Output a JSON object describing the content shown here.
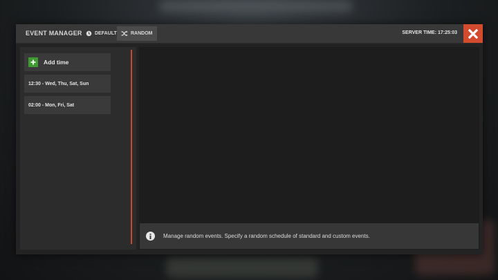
{
  "header": {
    "title": "EVENT MANAGER",
    "tabs": [
      {
        "label": "DEFAULT",
        "icon": "clock-icon"
      },
      {
        "label": "RANDOM",
        "icon": "shuffle-icon",
        "active": true
      }
    ],
    "server_time": "SERVER TIME: 17:25:03",
    "close_icon": "close-icon"
  },
  "sidebar": {
    "add_label": "Add time",
    "items": [
      {
        "label": "12:30 - Wed, Thu, Sat, Sun"
      },
      {
        "label": "02:00 - Mon, Fri, Sat"
      }
    ]
  },
  "info": {
    "text": "Manage random events. Specify a random schedule of standard and custom events."
  },
  "colors": {
    "accent": "#d24b2e",
    "add": "#3d9b2f",
    "panel": "#232323"
  }
}
